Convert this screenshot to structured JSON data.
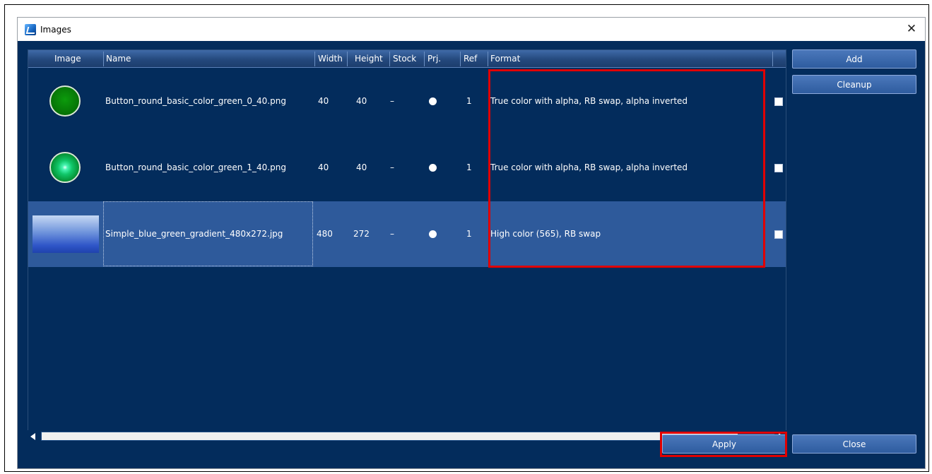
{
  "window": {
    "title": "Images",
    "close_glyph": "✕"
  },
  "columns": [
    "Image",
    "Name",
    "Width",
    "Height",
    "Stock",
    "Prj.",
    "Ref",
    "Format"
  ],
  "rows": [
    {
      "thumb": "green-button-icon",
      "name": "Button_round_basic_color_green_0_40.png",
      "width": "40",
      "height": "40",
      "stock": "–",
      "ref": "1",
      "format": "True color with alpha, RB swap, alpha inverted",
      "selected": false
    },
    {
      "thumb": "green-button-lit-icon",
      "name": "Button_round_basic_color_green_1_40.png",
      "width": "40",
      "height": "40",
      "stock": "–",
      "ref": "1",
      "format": "True color with alpha, RB swap, alpha inverted",
      "selected": false
    },
    {
      "thumb": "blue-gradient-thumbnail",
      "name": "Simple_blue_green_gradient_480x272.jpg",
      "width": "480",
      "height": "272",
      "stock": "–",
      "ref": "1",
      "format": "High color (565), RB swap",
      "selected": true
    }
  ],
  "buttons": {
    "add": "Add",
    "cleanup": "Cleanup",
    "apply": "Apply",
    "close": "Close"
  },
  "colors": {
    "background": "#032c5c",
    "selected_row": "#2e5a9b",
    "highlight": "#e00000",
    "button": "#3c6aad"
  }
}
